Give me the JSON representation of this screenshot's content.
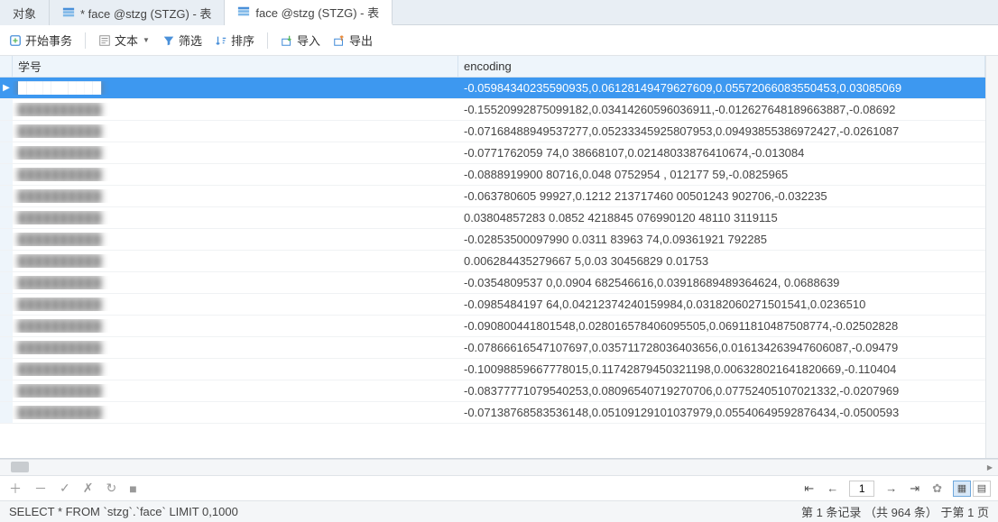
{
  "tabs": [
    {
      "label": "对象"
    },
    {
      "label": "* face @stzg (STZG) - 表"
    },
    {
      "label": "face @stzg (STZG) - 表"
    }
  ],
  "toolbar": {
    "begin_transaction": "开始事务",
    "text": "文本",
    "filter": "筛选",
    "sort": "排序",
    "import": "导入",
    "export": "导出"
  },
  "columns": {
    "col1": "学号",
    "col2": "encoding"
  },
  "rows": [
    {
      "id": "██████████",
      "enc": "-0.05984340235590935,0.06128149479627609,0.05572066083550453,0.03085069"
    },
    {
      "id": "██████████",
      "enc": "-0.15520992875099182,0.03414260596036911,-0.012627648189663887,-0.08692"
    },
    {
      "id": "██████████",
      "enc": "-0.07168488949537277,0.05233345925807953,0.09493855386972427,-0.0261087"
    },
    {
      "id": "██████████",
      "enc": "-0.0771762059        74,0         38668107,0.02148033876410674,-0.013084"
    },
    {
      "id": "██████████",
      "enc": "-0.0888919900   80716,0.048    0752954  ,    012177     59,-0.0825965"
    },
    {
      "id": "██████████",
      "enc": "-0.063780605    99927,0.1212   213717460   00501243    902706,-0.032235"
    },
    {
      "id": "██████████",
      "enc": "0.03804857283       0.0852   4218845    076990120   48110   3119115"
    },
    {
      "id": "██████████",
      "enc": "-0.02853500097990   0.0311   83963     74,0.09361921        792285"
    },
    {
      "id": "██████████",
      "enc": "0.006284435279667    5,0.03            30456829         0.01753"
    },
    {
      "id": "██████████",
      "enc": "-0.0354809537       0,0.0904    682546616,0.03918689489364624, 0.0688639"
    },
    {
      "id": "██████████",
      "enc": "-0.0985484197      64,0.04212374240159984,0.03182060271501541,0.0236510"
    },
    {
      "id": "██████████",
      "enc": "-0.090800441801548,0.028016578406095505,0.06911810487508774,-0.02502828"
    },
    {
      "id": "██████████",
      "enc": "-0.07866616547107697,0.035711728036403656,0.016134263947606087,-0.09479"
    },
    {
      "id": "██████████",
      "enc": "-0.10098859667778015,0.11742879450321198,0.006328021641820669,-0.110404"
    },
    {
      "id": "██████████",
      "enc": "-0.08377771079540253,0.08096540719270706,0.07752405107021332,-0.0207969"
    },
    {
      "id": "██████████",
      "enc": "-0.07138768583536148,0.05109129101037979,0.05540649592876434,-0.0500593"
    }
  ],
  "footer": {
    "page_value": "1",
    "record_text": "第 1 条记录 （共 964 条） 于第 1 页",
    "sql": "SELECT * FROM `stzg`.`face` LIMIT 0,1000"
  }
}
